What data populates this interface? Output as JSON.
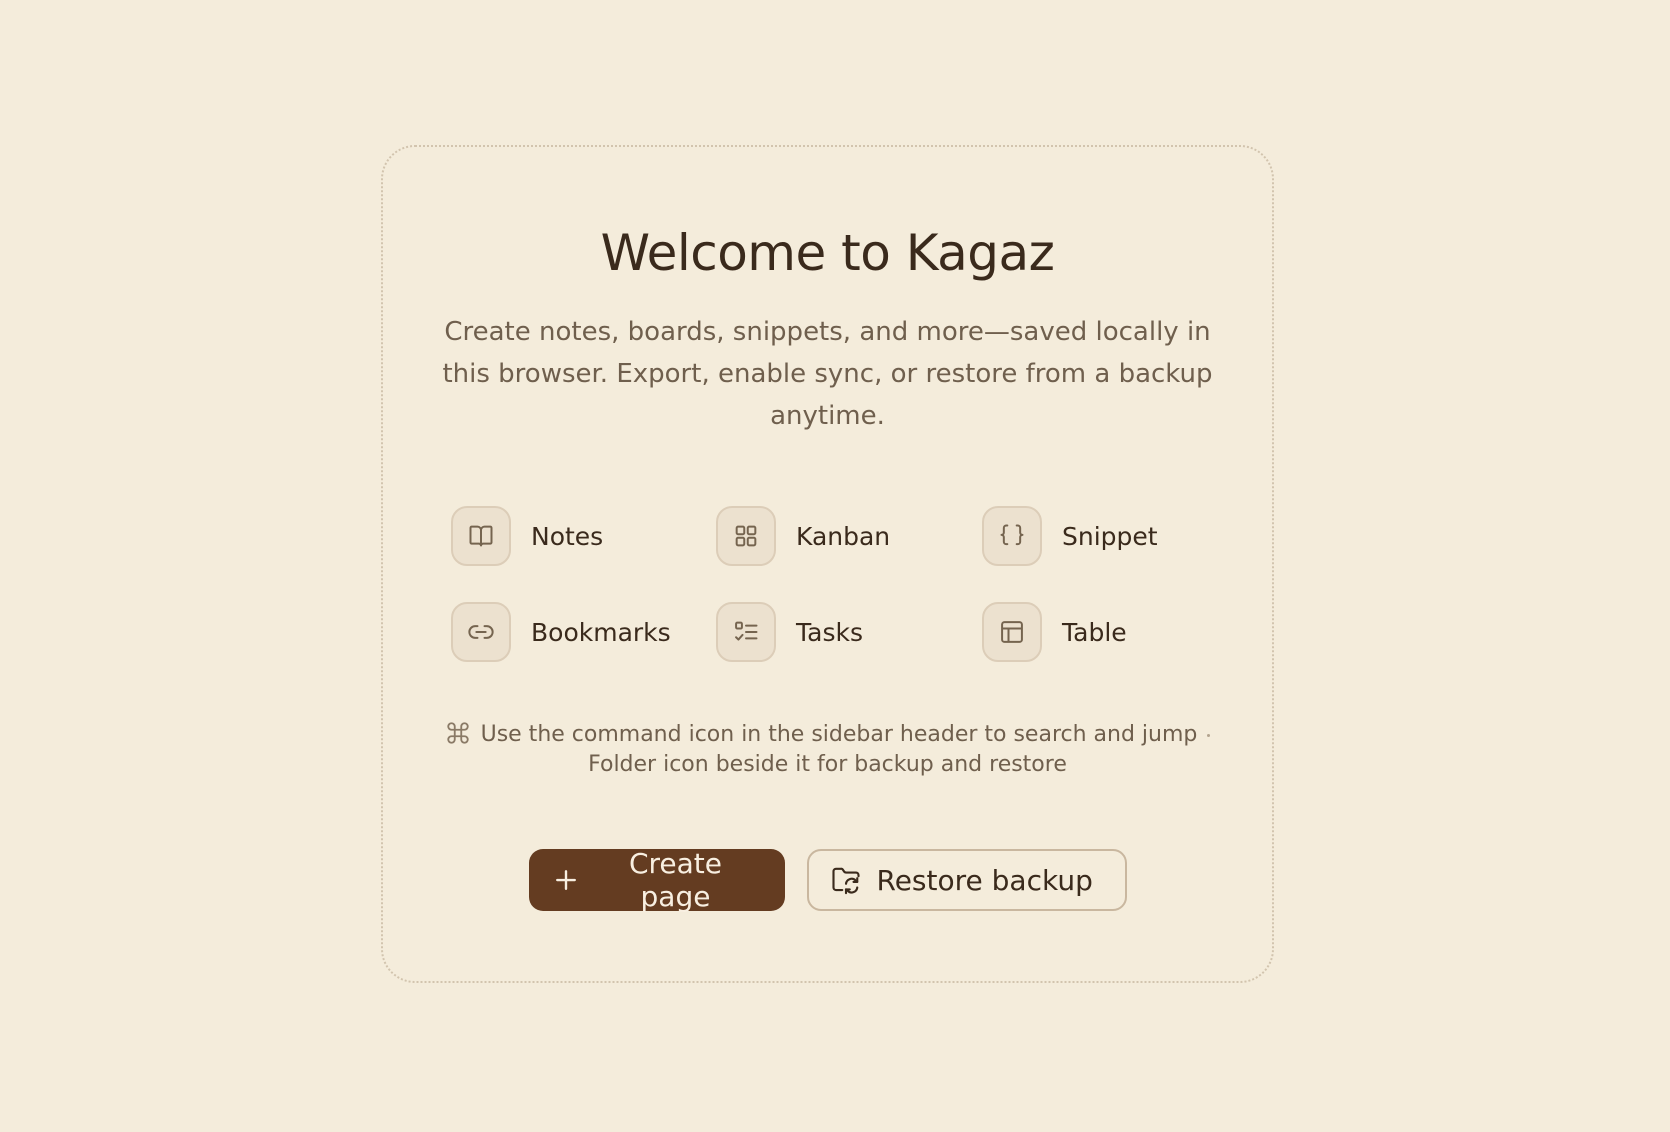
{
  "welcome": {
    "title": "Welcome to Kagaz",
    "subtitle": "Create notes, boards, snippets, and more—saved locally in this browser. Export, enable sync, or restore from a backup anytime."
  },
  "features": [
    {
      "label": "Notes",
      "icon": "book-open-icon"
    },
    {
      "label": "Kanban",
      "icon": "grid-icon"
    },
    {
      "label": "Snippet",
      "icon": "braces-icon"
    },
    {
      "label": "Bookmarks",
      "icon": "link-icon"
    },
    {
      "label": "Tasks",
      "icon": "checklist-icon"
    },
    {
      "label": "Table",
      "icon": "table-icon"
    }
  ],
  "hint": {
    "icon": "command-icon",
    "line1": "Use the command icon in the sidebar header to search and jump",
    "line2": "Folder icon beside it for backup and restore"
  },
  "actions": {
    "create_label": "Create page",
    "create_icon": "plus-icon",
    "restore_label": "Restore backup",
    "restore_icon": "folder-sync-icon"
  },
  "colors": {
    "background": "#f4ecdb",
    "primary": "#643c21",
    "text": "#3a2a1c",
    "muted": "#6f5f4d"
  }
}
